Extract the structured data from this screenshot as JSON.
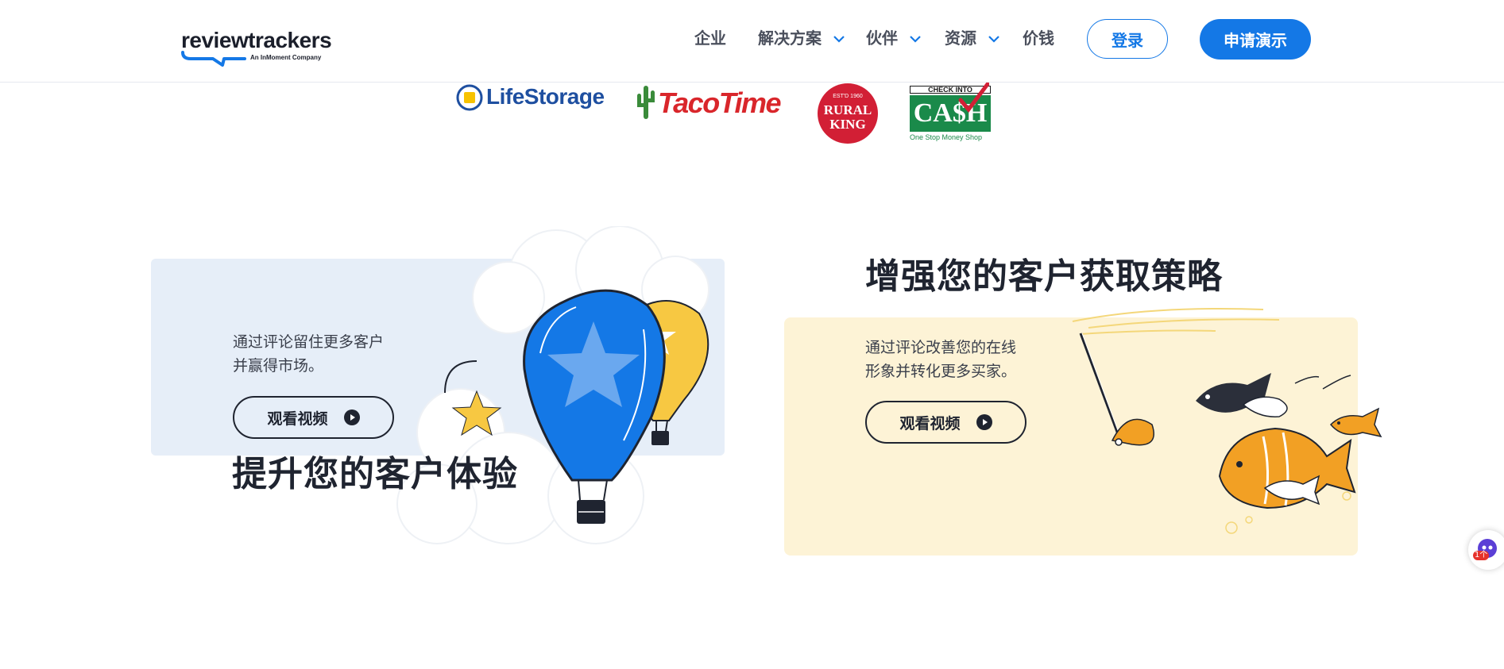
{
  "brand": {
    "logo_text": "reviewtrackers",
    "logo_subtext": "An InMoment Company"
  },
  "nav": {
    "items": [
      {
        "label": "企业",
        "has_dropdown": false
      },
      {
        "label": "解决方案",
        "has_dropdown": true
      },
      {
        "label": "伙伴",
        "has_dropdown": true
      },
      {
        "label": "资源",
        "has_dropdown": true
      },
      {
        "label": "价钱",
        "has_dropdown": false
      }
    ],
    "login_label": "登录",
    "demo_label": "申请演示"
  },
  "client_logos": {
    "life_storage": "LifeStorage",
    "taco_time": "TacoTime",
    "rural_king_est": "EST'D 1960",
    "rural_king_line1": "RURAL",
    "rural_king_line2": "KING",
    "check_into_cash_top": "CHECK INTO",
    "check_into_cash_main": "CA$H",
    "check_into_cash_tagline": "One Stop Money Shop"
  },
  "sections": [
    {
      "heading": "提升您的客户体验",
      "description_line1": "通过评论留住更多客户",
      "description_line2": "并赢得市场。",
      "button_label": "观看视频"
    },
    {
      "heading": "增强您的客户获取策略",
      "description_line1": "通过评论改善您的在线",
      "description_line2": "形象并转化更多买家。",
      "button_label": "观看视频"
    }
  ],
  "widget": {
    "badge": "1个"
  },
  "colors": {
    "brand_blue": "#1478e6",
    "dark_text": "#1f2430",
    "card_left_bg": "#e6eef8",
    "card_right_bg": "#fdf3d6",
    "balloon_yellow": "#f7c842",
    "fish_orange": "#f2a024"
  },
  "icons": [
    "chevron-down-icon",
    "play-icon",
    "speech-bubble-icon",
    "star-icon"
  ]
}
